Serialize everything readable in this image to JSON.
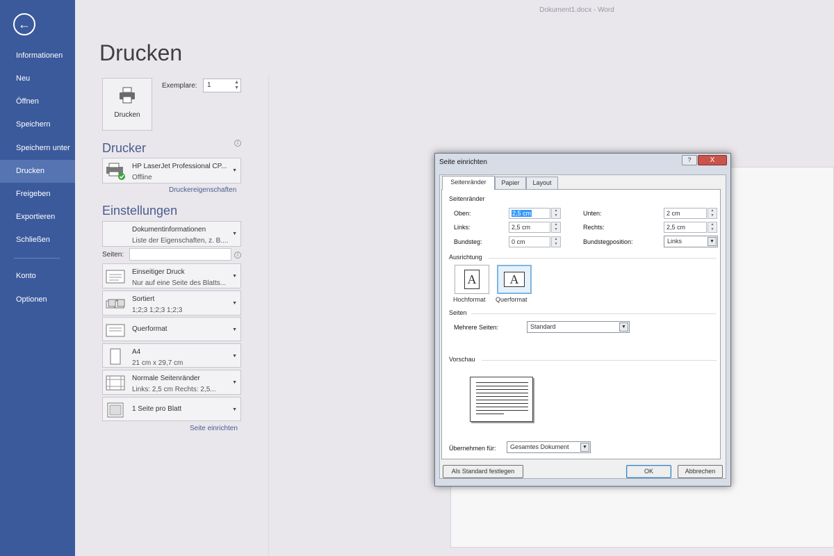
{
  "window": {
    "title": "Dokument1.docx - Word"
  },
  "sidebar": {
    "back": "←",
    "items": [
      {
        "label": "Informationen"
      },
      {
        "label": "Neu"
      },
      {
        "label": "Öffnen"
      },
      {
        "label": "Speichern"
      },
      {
        "label": "Speichern unter"
      },
      {
        "label": "Drucken"
      },
      {
        "label": "Freigeben"
      },
      {
        "label": "Exportieren"
      },
      {
        "label": "Schließen"
      },
      {
        "label": "Konto"
      },
      {
        "label": "Optionen"
      }
    ],
    "active": "Drucken"
  },
  "print": {
    "page_title": "Drucken",
    "button_label": "Drucken",
    "copies_label": "Exemplare:",
    "copies_value": "1"
  },
  "printer": {
    "section": "Drucker",
    "name": "HP LaserJet Professional CP...",
    "status": "Offline",
    "properties_link": "Druckereigenschaften"
  },
  "settings": {
    "section": "Einstellungen",
    "doc_info_title": "Dokumentinformationen",
    "doc_info_sub": "Liste der Eigenschaften, z. B....",
    "pages_label": "Seiten:",
    "pages_value": "",
    "duplex_title": "Einseitiger Druck",
    "duplex_sub": "Nur auf eine Seite des Blatts...",
    "collate_title": "Sortiert",
    "collate_sub": "1;2;3    1;2;3    1;2;3",
    "orientation_title": "Querformat",
    "paper_title": "A4",
    "paper_sub": "21  cm x 29,7  cm",
    "margins_title": "Normale Seitenränder",
    "margins_sub": "Links: 2,5  cm     Rechts: 2,5...",
    "pps_title": "1 Seite pro Blatt",
    "page_setup_link": "Seite einrichten"
  },
  "dialog": {
    "title": "Seite einrichten",
    "help": "?",
    "close": "X",
    "tabs": [
      "Seitenränder",
      "Papier",
      "Layout"
    ],
    "margins_group": "Seitenränder",
    "top_label": "Oben:",
    "top_value": "2,5 cm",
    "bottom_label": "Unten:",
    "bottom_value": "2 cm",
    "left_label": "Links:",
    "left_value": "2,5 cm",
    "right_label": "Rechts:",
    "right_value": "2,5 cm",
    "gutter_label": "Bundsteg:",
    "gutter_value": "0 cm",
    "gutter_pos_label": "Bundstegposition:",
    "gutter_pos_value": "Links",
    "orientation_group": "Ausrichtung",
    "portrait_label": "Hochformat",
    "landscape_label": "Querformat",
    "pages_group": "Seiten",
    "multiple_pages_label": "Mehrere Seiten:",
    "multiple_pages_value": "Standard",
    "preview_group": "Vorschau",
    "apply_label": "Übernehmen für:",
    "apply_value": "Gesamtes Dokument",
    "set_default_button": "Als Standard festlegen",
    "ok_button": "OK",
    "cancel_button": "Abbrechen"
  },
  "colors": {
    "sidebar": "#3b5a9c",
    "sidebar_active": "#5574b1",
    "accent_text": "#4a5c8e"
  }
}
